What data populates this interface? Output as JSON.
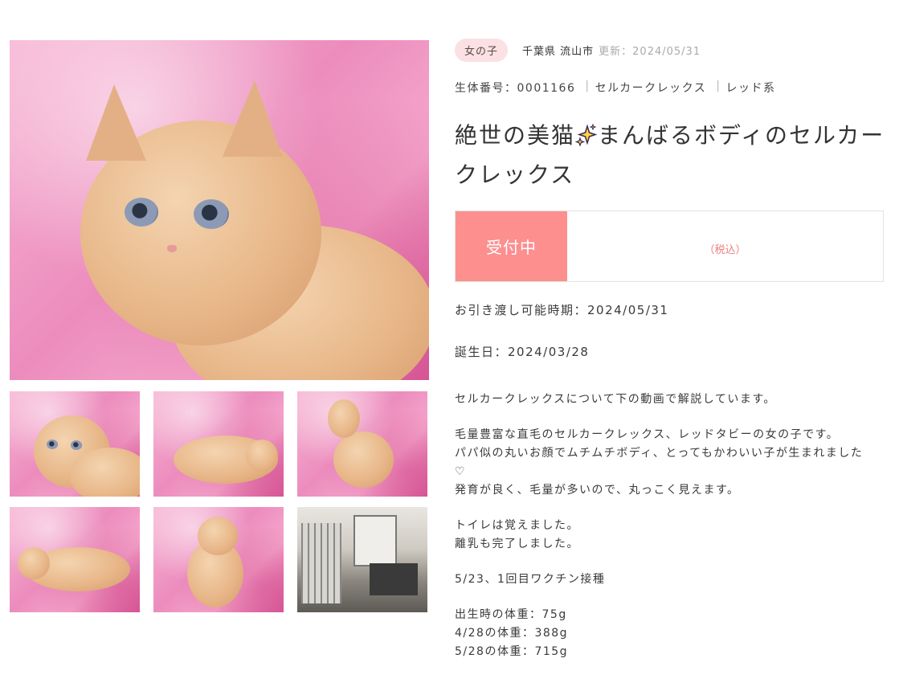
{
  "pet": {
    "gender_badge": "女の子",
    "location": "千葉県 流山市",
    "updated": "更新：2024/05/31",
    "id_text": "生体番号：0001166",
    "breed": "セルカークレックス",
    "color": "レッド系",
    "title_part1": "絶世の美猫",
    "title_part2": "まんばるボディのセルカークレックス",
    "status": "受付中",
    "price_note": "（税込）",
    "delivery_date": "お引き渡し可能時期：2024/05/31",
    "birthday": "誕生日：2024/03/28"
  },
  "description": {
    "p1": "セルカークレックスについて下の動画で解説しています。",
    "p2": "毛量豊富な直毛のセルカークレックス、レッドタビーの女の子です。\nパパ似の丸いお顔でムチムチボディ、とってもかわいい子が生まれました♡\n発育が良く、毛量が多いので、丸っこく見えます。",
    "p3": "トイレは覚えました。\n離乳も完了しました。",
    "p4": "5/23、1回目ワクチン接種",
    "p5": "出生時の体重：75g\n4/28の体重：388g\n5/28の体重：715g"
  },
  "gallery": {
    "main_photo": "kitten-photo",
    "thumbnails": [
      "kitten-face",
      "kitten-lying",
      "kitten-sitting-side",
      "kitten-walking",
      "kitten-sitting-front",
      "shop-room"
    ]
  },
  "colors": {
    "accent": "#fd8f8f",
    "badge_bg": "#fbe0e4",
    "price_text": "#f07c7c"
  },
  "icons": {
    "sparkle": "sparkles-emoji"
  }
}
